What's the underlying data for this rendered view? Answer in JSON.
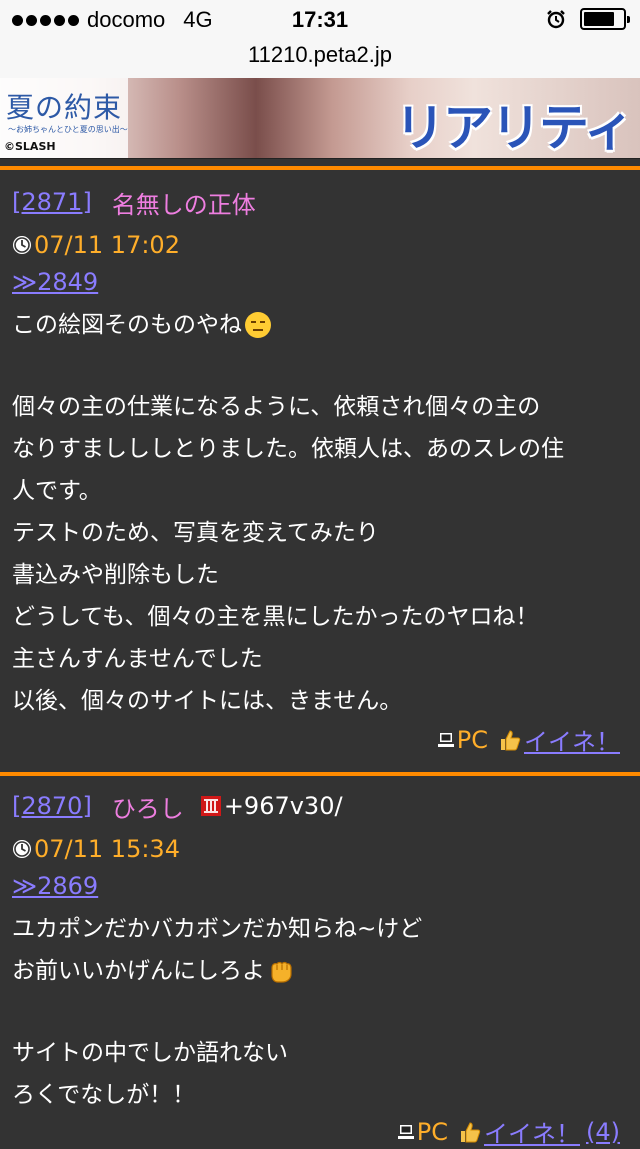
{
  "status_bar": {
    "carrier": "docomo",
    "network": "4G",
    "time": "17:31",
    "signal_bars": 5,
    "battery_level": 0.8,
    "icons": [
      "signal-dots-icon",
      "alarm-icon",
      "battery-icon"
    ]
  },
  "url_bar": {
    "url": "11210.peta2.jp"
  },
  "banner": {
    "title": "夏の約束",
    "subtitle": "〜お姉ちゃんとひと夏の思い出〜",
    "logo": "©SLASH",
    "tagline": "リアリティ"
  },
  "colors": {
    "background": "#333333",
    "accent_rule": "#ff8a00",
    "post_number": "#8a7cff",
    "name": "#ee7ee0",
    "timestamp": "#ffae2a"
  },
  "posts": [
    {
      "number": "[2871]",
      "name": "名無しの正体",
      "id": "",
      "timestamp": "07/11 17:02",
      "reply_to": "≫2849",
      "lines": [
        "この絵図そのものやね",
        "",
        "個々の主の仕業になるように、依頼され個々の主の",
        "なりすましししとりました。依頼人は、あのスレの住",
        "人です。",
        "テストのため、写真を変えてみたり",
        "書込みや削除もした",
        "どうしても、個々の主を黒にしたかったのヤロね！",
        "主さんすんませんでした",
        "以後、個々のサイトには、きません。"
      ],
      "device": "PC",
      "like_label": "イイネ！",
      "like_count": ""
    },
    {
      "number": "[2870]",
      "name": "ひろし",
      "id": "+967v30/",
      "timestamp": "07/11 15:34",
      "reply_to": "≫2869",
      "lines": [
        "ユカポンだかバカボンだか知らね~けど",
        "お前いいかげんにしろよ",
        "",
        "サイトの中でしか語れない",
        "ろくでなしが！！"
      ],
      "device": "PC",
      "like_label": "イイネ！",
      "like_count": "(4)"
    }
  ]
}
